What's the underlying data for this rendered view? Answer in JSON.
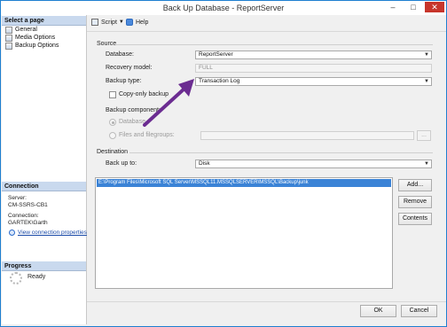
{
  "window": {
    "title": "Back Up Database - ReportServer",
    "controls": {
      "minimize": "–",
      "maximize": "□",
      "close": "✕"
    }
  },
  "left_pane": {
    "select_page": {
      "header": "Select a page",
      "items": [
        {
          "label": "General",
          "icon": "page-icon"
        },
        {
          "label": "Media Options",
          "icon": "page-icon"
        },
        {
          "label": "Backup Options",
          "icon": "page-icon"
        }
      ]
    },
    "connection": {
      "header": "Connection",
      "server_label": "Server:",
      "server_value": "CM-SSRS-CB1",
      "connection_label": "Connection:",
      "connection_value": "GARTEK\\Garth",
      "view_link": "View connection properties"
    },
    "progress": {
      "header": "Progress",
      "status": "Ready"
    }
  },
  "toolbar": {
    "script_label": "Script",
    "help_label": "Help"
  },
  "source": {
    "section_label": "Source",
    "database_label": "Database:",
    "database_value": "ReportServer",
    "recovery_label": "Recovery model:",
    "recovery_value": "FULL",
    "backup_type_label": "Backup type:",
    "backup_type_value": "Transaction Log",
    "copy_only_label": "Copy-only backup",
    "copy_only_checked": false,
    "component_label": "Backup component:",
    "component_database": "Database",
    "component_files": "Files and filegroups:",
    "browse_label": "..."
  },
  "destination": {
    "section_label": "Destination",
    "back_up_to_label": "Back up to:",
    "back_up_to_value": "Disk",
    "paths": [
      "E:\\Program Files\\Microsoft SQL Server\\MSSQL11.MSSQLSERVER\\MSSQL\\Backup\\junk"
    ],
    "add_label": "Add...",
    "remove_label": "Remove",
    "contents_label": "Contents"
  },
  "footer": {
    "ok_label": "OK",
    "cancel_label": "Cancel"
  },
  "colors": {
    "annotation_arrow": "#6b2c91",
    "selection": "#3b83d6",
    "pane_header": "#c9d9ee",
    "window_border": "#1e7fd0"
  }
}
